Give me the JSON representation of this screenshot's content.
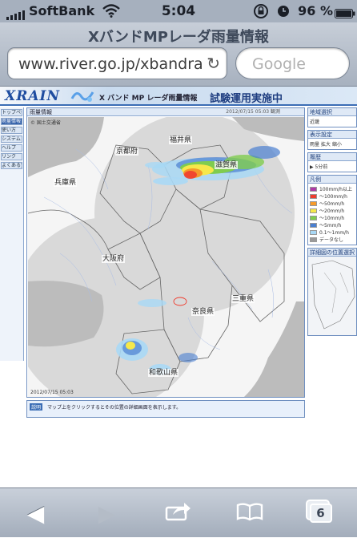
{
  "status": {
    "carrier": "SoftBank",
    "time": "5:04",
    "battery": "96 %"
  },
  "browser": {
    "page_title": "XバンドMPレーダ雨量情報",
    "url": "www.river.go.jp/xbandra",
    "search_placeholder": "Google"
  },
  "site": {
    "logo": "XRAIN",
    "subtitle": "X バンド MP レーダ雨量情報",
    "trial": "試験運用実施中",
    "left_nav": [
      "トップページ",
      "雨量情報",
      "使い方",
      "システム",
      "ヘルプ",
      "リンク",
      "よくある質問"
    ],
    "map_header": "雨量情報",
    "map_timestamp": "2012/07/15 05:03 観測",
    "map_copyright": "© 国土交通省",
    "map_bottom_ts": "2012/07/15 05:03",
    "hint_tag": "説明",
    "hint_text": "マップ上をクリックするとその位置の詳細画面を表示します。",
    "map_labels": {
      "fukui": "福井県",
      "kyoto": "京都府",
      "shiga": "滋賀県",
      "hyogo": "兵庫県",
      "osaka": "大阪府",
      "mie": "三重県",
      "nara": "奈良県",
      "wakayama": "和歌山県"
    },
    "right": {
      "area_title": "地域選択",
      "area_value": "近畿",
      "display_title": "表示設定",
      "display_value": "雨量 拡大 縮小",
      "history_title": "履歴",
      "history_value": "▶  5分前",
      "legend_title": "凡例",
      "legend": [
        {
          "label": "100mm/h以上",
          "color": "#b03aa8"
        },
        {
          "label": "～100mm/h",
          "color": "#ef3d2f"
        },
        {
          "label": "～50mm/h",
          "color": "#f59a2a"
        },
        {
          "label": "～20mm/h",
          "color": "#f6e84a"
        },
        {
          "label": "～10mm/h",
          "color": "#7fcc4f"
        },
        {
          "label": "～5mm/h",
          "color": "#4a7fd0"
        },
        {
          "label": "0.1～1mm/h",
          "color": "#a8d8f5"
        },
        {
          "label": "データなし",
          "color": "#9a9a9a"
        }
      ],
      "detail_title": "詳細図の位置選択"
    }
  },
  "toolbar": {
    "tab_count": "6"
  },
  "icons": {
    "wifi": "wifi-icon",
    "lock": "rotation-lock-icon",
    "alarm": "alarm-icon",
    "reload": "reload-icon",
    "back": "back-arrow-icon",
    "forward": "forward-arrow-icon",
    "share": "share-icon",
    "bookmarks": "bookmarks-icon",
    "tabs": "tabs-icon"
  }
}
